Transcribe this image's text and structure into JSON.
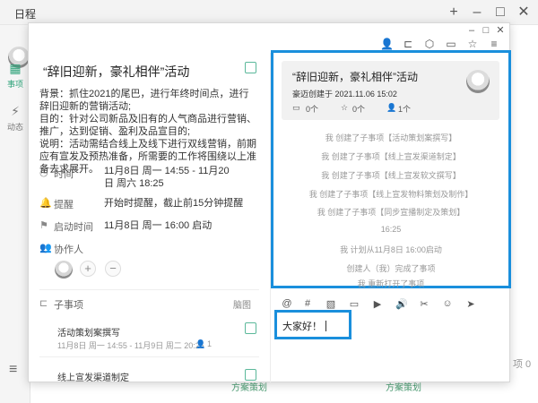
{
  "app": {
    "title": "日程",
    "nav": [
      {
        "label": "事项",
        "icon": "calendar-icon"
      },
      {
        "label": "动态",
        "icon": "activity-icon"
      }
    ],
    "bottom_texts": [
      "方案策划",
      "方案策划"
    ],
    "right_text": "项 0"
  },
  "task": {
    "title": "“辞旧迎新，豪礼相伴”活动",
    "description": [
      "背景：抓住2021的尾巴，进行年终时间点，进行辞旧迎新的营销活动;",
      "目的：针对公司新品及旧有的人气商品进行营销、推广，达到促销、盈利及品宣目的;",
      "说明：活动需结合线上及线下进行双线营销，前期应有宣发及预热准备，所需要的工作将围绕以上准备去求展开。"
    ],
    "time_label": "时间",
    "time_value": "11月8日 周一 14:55 - 11月20日 周六 18:25",
    "reminder_label": "提醒",
    "reminder_value": "开始时提醒，截止前15分钟提醒",
    "start_label": "启动时间",
    "start_value": "11月8日 周一 16:00 启动",
    "collaborator_label": "协作人",
    "subtask_label": "子事项",
    "subtask_view": "脑图",
    "subtasks": [
      {
        "title": "活动策划案撰写",
        "meta": "11月8日 周一 14:55 - 11月9日 周二 20:25",
        "count": "1"
      },
      {
        "title": "线上宣发渠道制定",
        "meta": "",
        "count": ""
      }
    ]
  },
  "card": {
    "title": "“辞旧迎新，豪礼相伴”活动",
    "meta": "豪迈创建于 2021.11.06 15:02",
    "folders": "0个",
    "stars": "0个",
    "people": "1个"
  },
  "activity": [
    "我 创建了子事项【活动策划案撰写】",
    "我 创建了子事项【线上宣发渠道制定】",
    "我 创建了子事项【线上宣发软文撰写】",
    "我 创建了子事项【线上宣发物料策划及制作】",
    "我 创建了子事项【同步宣播制定及策划】",
    "16:25",
    "我 计划从11月8日 16:00启动",
    "创建人（我）完成了事项",
    "我 重新打开了事项"
  ],
  "comment": {
    "draft": "大家好！"
  }
}
